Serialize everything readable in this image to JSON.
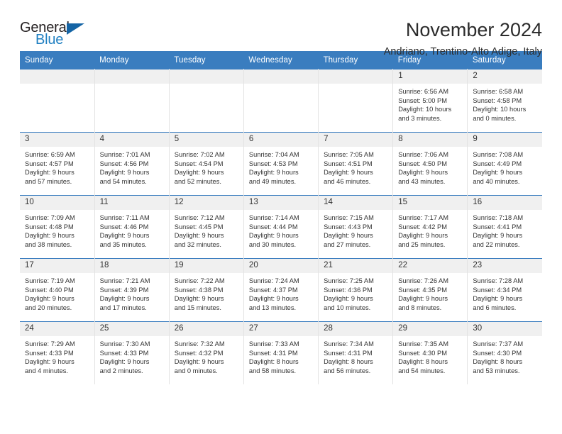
{
  "brand": {
    "name_part1": "General",
    "name_part2": "Blue",
    "logo_icon": "blue-triangle-mark",
    "accent_color": "#1f7fc1",
    "header_color": "#3a7dbf"
  },
  "header": {
    "title": "November 2024",
    "location": "Andriano, Trentino-Alto Adige, Italy"
  },
  "calendar": {
    "weekday_headers": [
      "Sunday",
      "Monday",
      "Tuesday",
      "Wednesday",
      "Thursday",
      "Friday",
      "Saturday"
    ],
    "labels": {
      "sunrise": "Sunrise:",
      "sunset": "Sunset:",
      "daylight": "Daylight:"
    },
    "weeks": [
      [
        {
          "day": ""
        },
        {
          "day": ""
        },
        {
          "day": ""
        },
        {
          "day": ""
        },
        {
          "day": ""
        },
        {
          "day": "1",
          "sunrise": "Sunrise: 6:56 AM",
          "sunset": "Sunset: 5:00 PM",
          "daylight_line1": "Daylight: 10 hours",
          "daylight_line2": "and 3 minutes."
        },
        {
          "day": "2",
          "sunrise": "Sunrise: 6:58 AM",
          "sunset": "Sunset: 4:58 PM",
          "daylight_line1": "Daylight: 10 hours",
          "daylight_line2": "and 0 minutes."
        }
      ],
      [
        {
          "day": "3",
          "sunrise": "Sunrise: 6:59 AM",
          "sunset": "Sunset: 4:57 PM",
          "daylight_line1": "Daylight: 9 hours",
          "daylight_line2": "and 57 minutes."
        },
        {
          "day": "4",
          "sunrise": "Sunrise: 7:01 AM",
          "sunset": "Sunset: 4:56 PM",
          "daylight_line1": "Daylight: 9 hours",
          "daylight_line2": "and 54 minutes."
        },
        {
          "day": "5",
          "sunrise": "Sunrise: 7:02 AM",
          "sunset": "Sunset: 4:54 PM",
          "daylight_line1": "Daylight: 9 hours",
          "daylight_line2": "and 52 minutes."
        },
        {
          "day": "6",
          "sunrise": "Sunrise: 7:04 AM",
          "sunset": "Sunset: 4:53 PM",
          "daylight_line1": "Daylight: 9 hours",
          "daylight_line2": "and 49 minutes."
        },
        {
          "day": "7",
          "sunrise": "Sunrise: 7:05 AM",
          "sunset": "Sunset: 4:51 PM",
          "daylight_line1": "Daylight: 9 hours",
          "daylight_line2": "and 46 minutes."
        },
        {
          "day": "8",
          "sunrise": "Sunrise: 7:06 AM",
          "sunset": "Sunset: 4:50 PM",
          "daylight_line1": "Daylight: 9 hours",
          "daylight_line2": "and 43 minutes."
        },
        {
          "day": "9",
          "sunrise": "Sunrise: 7:08 AM",
          "sunset": "Sunset: 4:49 PM",
          "daylight_line1": "Daylight: 9 hours",
          "daylight_line2": "and 40 minutes."
        }
      ],
      [
        {
          "day": "10",
          "sunrise": "Sunrise: 7:09 AM",
          "sunset": "Sunset: 4:48 PM",
          "daylight_line1": "Daylight: 9 hours",
          "daylight_line2": "and 38 minutes."
        },
        {
          "day": "11",
          "sunrise": "Sunrise: 7:11 AM",
          "sunset": "Sunset: 4:46 PM",
          "daylight_line1": "Daylight: 9 hours",
          "daylight_line2": "and 35 minutes."
        },
        {
          "day": "12",
          "sunrise": "Sunrise: 7:12 AM",
          "sunset": "Sunset: 4:45 PM",
          "daylight_line1": "Daylight: 9 hours",
          "daylight_line2": "and 32 minutes."
        },
        {
          "day": "13",
          "sunrise": "Sunrise: 7:14 AM",
          "sunset": "Sunset: 4:44 PM",
          "daylight_line1": "Daylight: 9 hours",
          "daylight_line2": "and 30 minutes."
        },
        {
          "day": "14",
          "sunrise": "Sunrise: 7:15 AM",
          "sunset": "Sunset: 4:43 PM",
          "daylight_line1": "Daylight: 9 hours",
          "daylight_line2": "and 27 minutes."
        },
        {
          "day": "15",
          "sunrise": "Sunrise: 7:17 AM",
          "sunset": "Sunset: 4:42 PM",
          "daylight_line1": "Daylight: 9 hours",
          "daylight_line2": "and 25 minutes."
        },
        {
          "day": "16",
          "sunrise": "Sunrise: 7:18 AM",
          "sunset": "Sunset: 4:41 PM",
          "daylight_line1": "Daylight: 9 hours",
          "daylight_line2": "and 22 minutes."
        }
      ],
      [
        {
          "day": "17",
          "sunrise": "Sunrise: 7:19 AM",
          "sunset": "Sunset: 4:40 PM",
          "daylight_line1": "Daylight: 9 hours",
          "daylight_line2": "and 20 minutes."
        },
        {
          "day": "18",
          "sunrise": "Sunrise: 7:21 AM",
          "sunset": "Sunset: 4:39 PM",
          "daylight_line1": "Daylight: 9 hours",
          "daylight_line2": "and 17 minutes."
        },
        {
          "day": "19",
          "sunrise": "Sunrise: 7:22 AM",
          "sunset": "Sunset: 4:38 PM",
          "daylight_line1": "Daylight: 9 hours",
          "daylight_line2": "and 15 minutes."
        },
        {
          "day": "20",
          "sunrise": "Sunrise: 7:24 AM",
          "sunset": "Sunset: 4:37 PM",
          "daylight_line1": "Daylight: 9 hours",
          "daylight_line2": "and 13 minutes."
        },
        {
          "day": "21",
          "sunrise": "Sunrise: 7:25 AM",
          "sunset": "Sunset: 4:36 PM",
          "daylight_line1": "Daylight: 9 hours",
          "daylight_line2": "and 10 minutes."
        },
        {
          "day": "22",
          "sunrise": "Sunrise: 7:26 AM",
          "sunset": "Sunset: 4:35 PM",
          "daylight_line1": "Daylight: 9 hours",
          "daylight_line2": "and 8 minutes."
        },
        {
          "day": "23",
          "sunrise": "Sunrise: 7:28 AM",
          "sunset": "Sunset: 4:34 PM",
          "daylight_line1": "Daylight: 9 hours",
          "daylight_line2": "and 6 minutes."
        }
      ],
      [
        {
          "day": "24",
          "sunrise": "Sunrise: 7:29 AM",
          "sunset": "Sunset: 4:33 PM",
          "daylight_line1": "Daylight: 9 hours",
          "daylight_line2": "and 4 minutes."
        },
        {
          "day": "25",
          "sunrise": "Sunrise: 7:30 AM",
          "sunset": "Sunset: 4:33 PM",
          "daylight_line1": "Daylight: 9 hours",
          "daylight_line2": "and 2 minutes."
        },
        {
          "day": "26",
          "sunrise": "Sunrise: 7:32 AM",
          "sunset": "Sunset: 4:32 PM",
          "daylight_line1": "Daylight: 9 hours",
          "daylight_line2": "and 0 minutes."
        },
        {
          "day": "27",
          "sunrise": "Sunrise: 7:33 AM",
          "sunset": "Sunset: 4:31 PM",
          "daylight_line1": "Daylight: 8 hours",
          "daylight_line2": "and 58 minutes."
        },
        {
          "day": "28",
          "sunrise": "Sunrise: 7:34 AM",
          "sunset": "Sunset: 4:31 PM",
          "daylight_line1": "Daylight: 8 hours",
          "daylight_line2": "and 56 minutes."
        },
        {
          "day": "29",
          "sunrise": "Sunrise: 7:35 AM",
          "sunset": "Sunset: 4:30 PM",
          "daylight_line1": "Daylight: 8 hours",
          "daylight_line2": "and 54 minutes."
        },
        {
          "day": "30",
          "sunrise": "Sunrise: 7:37 AM",
          "sunset": "Sunset: 4:30 PM",
          "daylight_line1": "Daylight: 8 hours",
          "daylight_line2": "and 53 minutes."
        }
      ]
    ]
  }
}
